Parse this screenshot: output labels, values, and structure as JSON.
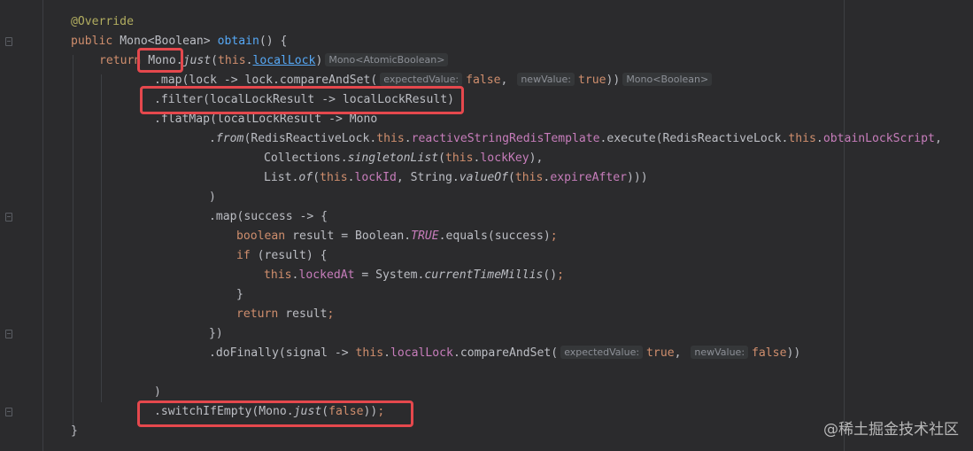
{
  "editor": {
    "lines": {
      "l1": {
        "t0": "@Override"
      },
      "l2": {
        "t0": "public ",
        "t1": "Mono<Boolean> ",
        "t2": "obtain",
        "t3": "() {"
      },
      "l3": {
        "t0": "return ",
        "t1": "Mono.",
        "t2": "just",
        "t3": "(",
        "t4": "this",
        "t5": ".",
        "t6": "localLock",
        "t7": ")",
        "hint": "Mono<AtomicBoolean>"
      },
      "l4": {
        "t0": ".map(lock -> lock.compareAndSet(",
        "hint1": "expectedValue:",
        "t1": "false",
        "t2": ", ",
        "hint2": "newValue:",
        "t3": "true",
        "t4": "))",
        "hint3": "Mono<Boolean>"
      },
      "l5": {
        "t0": ".filter(localLockResult -> localLockResult)"
      },
      "l6": {
        "t0": ".flatMap(localLockResult -> Mono"
      },
      "l7": {
        "t0": ".",
        "t1": "from",
        "t2": "(RedisReactiveLock.",
        "t3": "this",
        "t4": ".",
        "t5": "reactiveStringRedisTemplate",
        "t6": ".execute(RedisReactiveLock.",
        "t7": "this",
        "t8": ".",
        "t9": "obtainLockScript",
        "t10": ","
      },
      "l8": {
        "t0": "Collections.",
        "t1": "singletonList",
        "t2": "(",
        "t3": "this",
        "t4": ".",
        "t5": "lockKey",
        "t6": "),"
      },
      "l9": {
        "t0": "List.",
        "t1": "of",
        "t2": "(",
        "t3": "this",
        "t4": ".",
        "t5": "lockId",
        "t6": ", String.",
        "t7": "valueOf",
        "t8": "(",
        "t9": "this",
        "t10": ".",
        "t11": "expireAfter",
        "t12": ")))"
      },
      "l10": {
        "t0": ")"
      },
      "l11": {
        "t0": ".map(success -> {"
      },
      "l12": {
        "t0": "boolean ",
        "t1": "result = Boolean.",
        "t2": "TRUE",
        "t3": ".equals(success)",
        "t4": ";"
      },
      "l13": {
        "t0": "if ",
        "t1": "(result) {"
      },
      "l14": {
        "t0": "this",
        "t1": ".",
        "t2": "lockedAt",
        "t3": " = System.",
        "t4": "currentTimeMillis",
        "t5": "()",
        "t6": ";"
      },
      "l15": {
        "t0": "}"
      },
      "l16": {
        "t0": "return ",
        "t1": "result",
        "t2": ";"
      },
      "l17": {
        "t0": "})"
      },
      "l18": {
        "t0": ".doFinally(signal -> ",
        "t1": "this",
        "t2": ".",
        "t3": "localLock",
        "t4": ".compareAndSet(",
        "hint1": "expectedValue:",
        "t5": "true",
        "t6": ", ",
        "hint2": "newValue:",
        "t7": "false",
        "t8": "))"
      },
      "l19": {
        "t0": ")"
      },
      "l20": {
        "t0": ".switchIfEmpty(Mono.",
        "t1": "just",
        "t2": "(",
        "t3": "false",
        "t4": "))",
        "t5": ";"
      },
      "l21": {
        "t0": "}"
      }
    }
  },
  "watermark": "@稀土掘金技术社区"
}
